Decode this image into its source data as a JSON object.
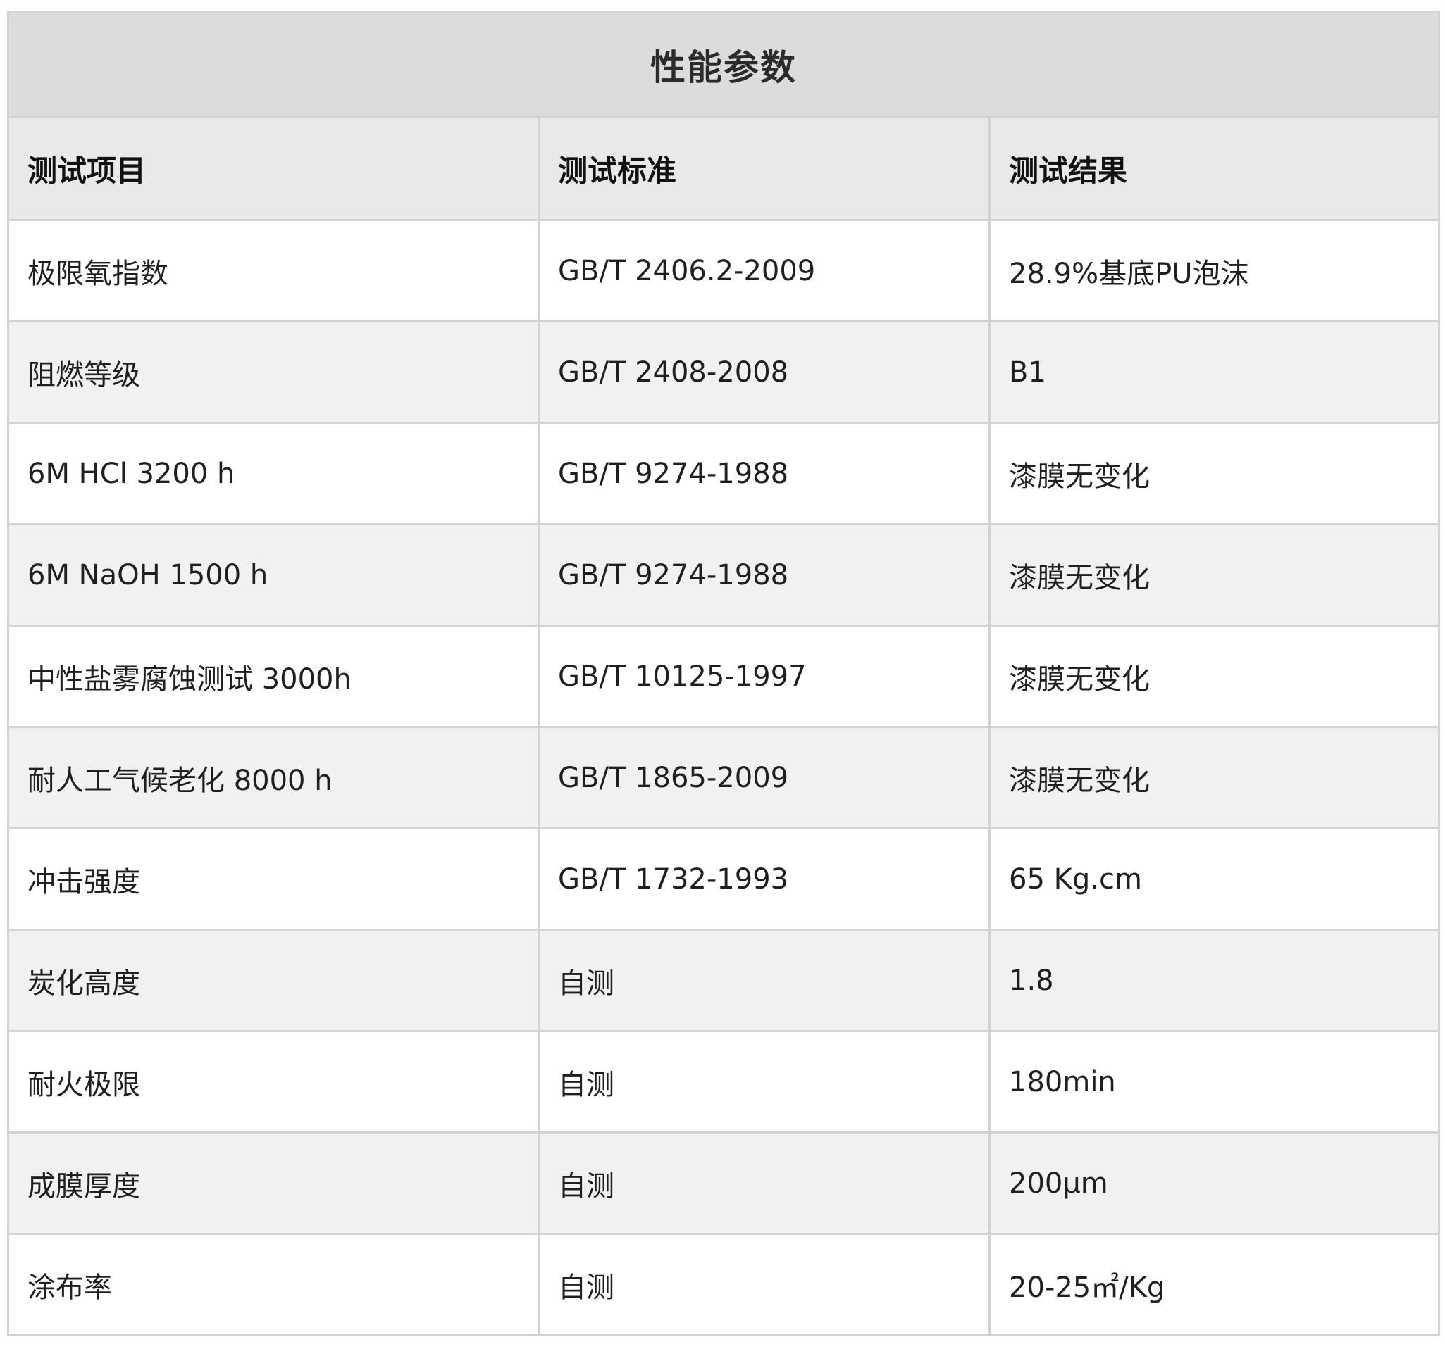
{
  "title": "性能参数",
  "headers": [
    "测试项目",
    "测试标准",
    "测试结果"
  ],
  "rows": [
    [
      "极限氧指数",
      "GB/T 2406.2-2009",
      "28.9%基底PU泡沫"
    ],
    [
      "阻燃等级",
      "GB/T 2408-2008",
      "B1"
    ],
    [
      "6M HCl 3200 h",
      "GB/T 9274-1988",
      "漆膜无变化"
    ],
    [
      "6M NaOH 1500 h",
      "GB/T 9274-1988",
      "漆膜无变化"
    ],
    [
      "中性盐雾腐蚀测试 3000h",
      "GB/T 10125-1997",
      "漆膜无变化"
    ],
    [
      "耐人工气候老化 8000 h",
      "GB/T 1865-2009",
      "漆膜无变化"
    ],
    [
      "冲击强度",
      "GB/T 1732-1993",
      "65 Kg.cm"
    ],
    [
      "炭化高度",
      "自测",
      "1.8"
    ],
    [
      "耐火极限",
      "自测",
      "180min"
    ],
    [
      "成膜厚度",
      "自测",
      "200μm"
    ],
    [
      "涂布率",
      "自测",
      "20-25㎡/Kg"
    ]
  ],
  "colors": {
    "title_bg": "#dcdcdc",
    "header_bg": "#e9e9e9",
    "row_even_bg": "#f1f1ef",
    "row_odd_bg": "#ffffff",
    "border": "#d2d2d2"
  }
}
